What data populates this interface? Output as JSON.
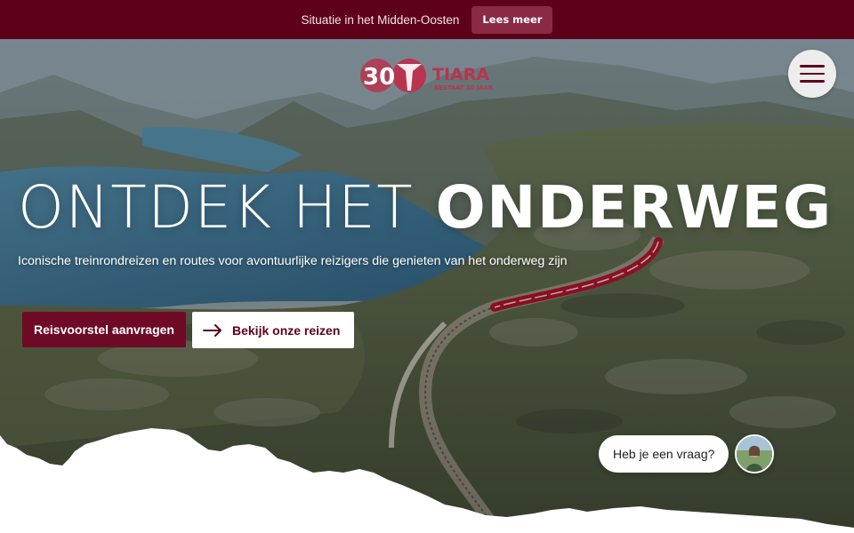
{
  "announcement": {
    "text": "Situatie in het Midden-Oosten",
    "button_label": "Lees meer"
  },
  "header": {
    "logo_number": "30",
    "logo_brand": "TIARA",
    "logo_tagline": "BESTAAT 30 JAAR",
    "menu_icon": "hamburger-menu-icon"
  },
  "hero": {
    "headline_light": "ONTDEK HET",
    "headline_bold": "ONDERWEG",
    "subline": "Iconische treinrondreizen en routes voor avontuurlijke reizigers die genieten van het onderweg zijn",
    "primary_cta": "Reisvoorstel aanvragen",
    "secondary_cta": "Bekijk onze reizen",
    "secondary_icon": "arrow-right-icon"
  },
  "chat": {
    "prompt": "Heb je een vraag?"
  },
  "colors": {
    "brand_dark": "#5e0019",
    "brand_button": "#6e0a26",
    "logo_accent": "#b8344f"
  }
}
